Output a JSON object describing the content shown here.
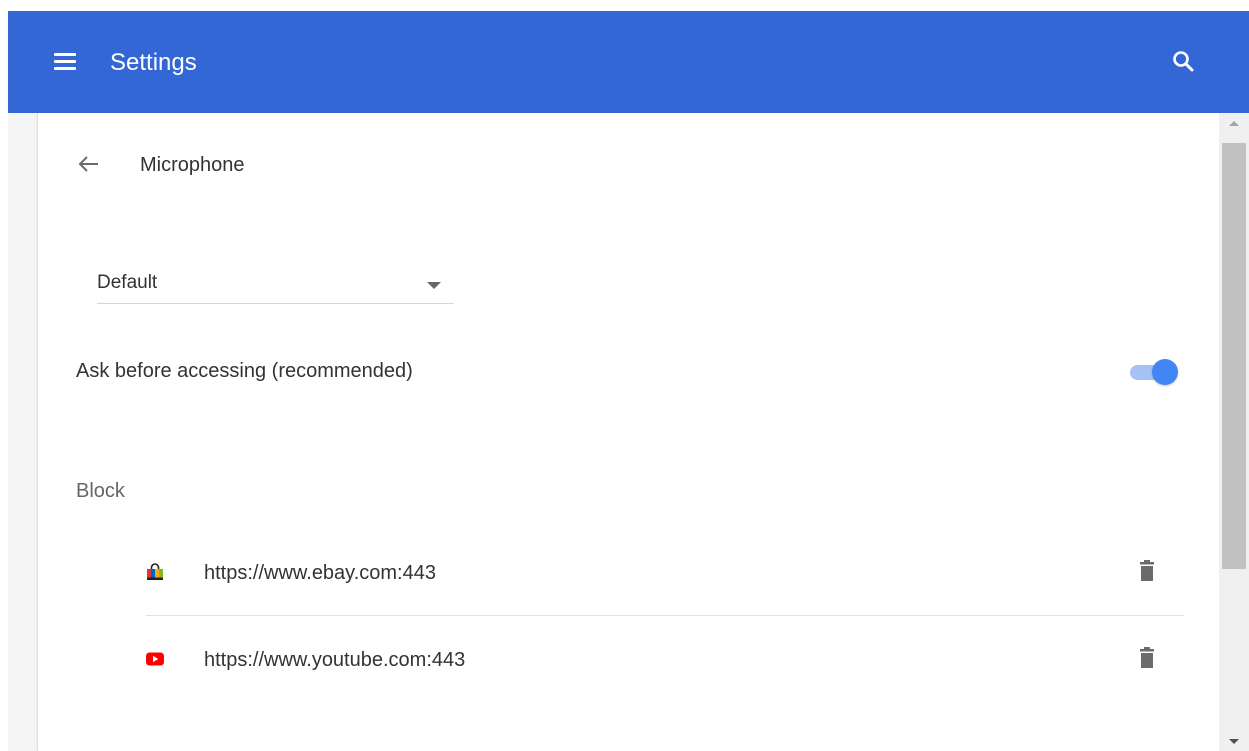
{
  "header": {
    "title": "Settings",
    "menu_icon": "hamburger-menu-icon",
    "search_icon": "search-icon",
    "accent_color": "#3367d6"
  },
  "page": {
    "title": "Microphone",
    "back_icon": "back-arrow-icon"
  },
  "device_select": {
    "selected": "Default",
    "icon": "dropdown-arrow-icon"
  },
  "ask_setting": {
    "label": "Ask before accessing (recommended)",
    "enabled": true,
    "toggle_color": "#4285f4"
  },
  "block_section": {
    "label": "Block",
    "sites": [
      {
        "url": "https://www.ebay.com:443",
        "icon": "ebay-favicon",
        "delete_icon": "trash-icon"
      },
      {
        "url": "https://www.youtube.com:443",
        "icon": "youtube-favicon",
        "delete_icon": "trash-icon"
      }
    ]
  },
  "scrollbar": {
    "up_icon": "scroll-up-arrow-icon",
    "down_icon": "scroll-down-arrow-icon"
  }
}
